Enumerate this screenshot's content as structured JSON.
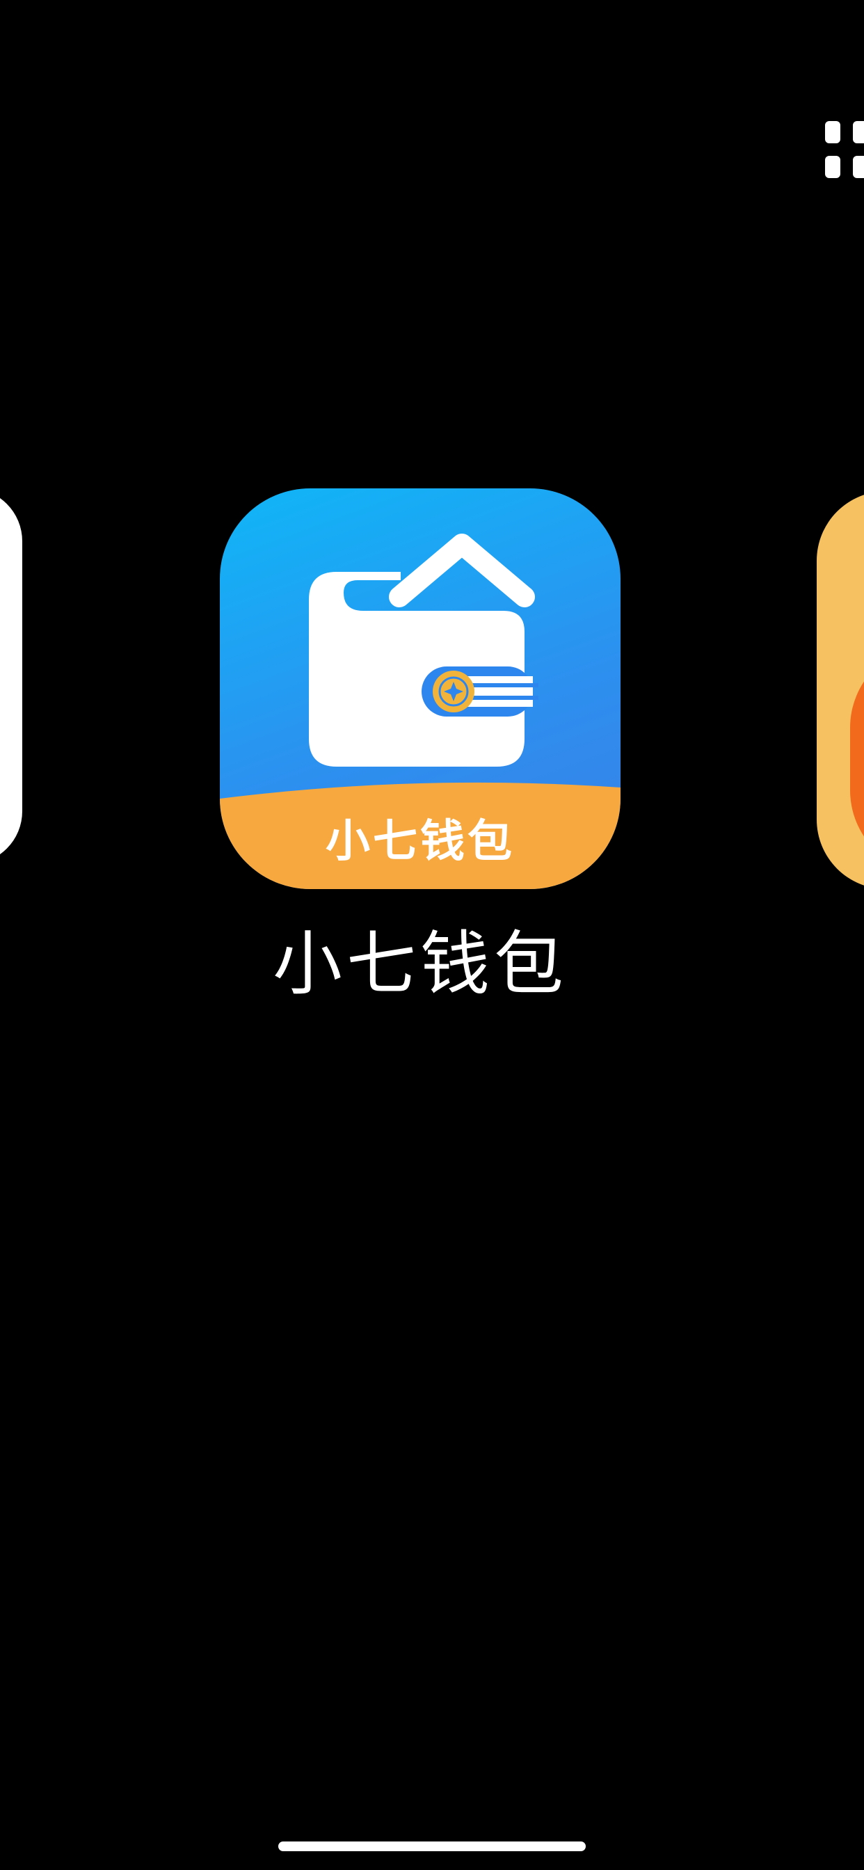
{
  "app": {
    "name": "小七钱包",
    "icon_text": "小七钱包",
    "icon_name": "wallet-icon"
  },
  "neighbors": {
    "left_icon_name": "app-icon-left",
    "right_icon_name": "app-icon-right"
  },
  "top_right_icon": "grid-icon",
  "colors": {
    "icon_blue_top": "#10b6f7",
    "icon_blue_bottom": "#3a7fe6",
    "icon_orange_band": "#f7a93f",
    "coin_gold": "#f2b33a",
    "background": "#000000"
  }
}
